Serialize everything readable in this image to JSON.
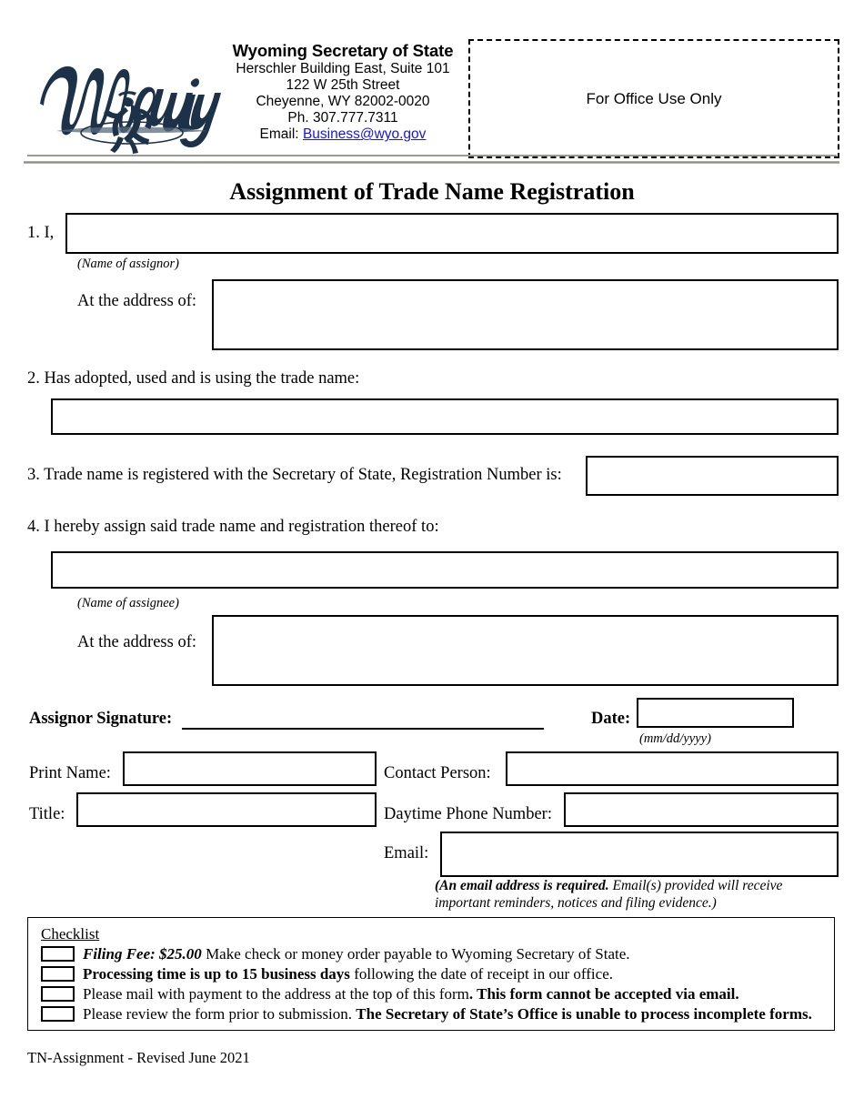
{
  "header": {
    "logo_alt": "Wyoming bucking horse logo",
    "agency_name": "Wyoming Secretary of State",
    "address_line1": "Herschler Building East, Suite 101",
    "address_line2": "122 W 25th Street",
    "address_line3": "Cheyenne, WY 82002-0020",
    "phone": "Ph. 307.777.7311",
    "email_label": "Email:",
    "email_value": "Business@wyo.gov",
    "office_use": "For Office Use Only",
    "link_color": "#1415e0"
  },
  "title": "Assignment of Trade Name Registration",
  "items": {
    "item1_label": "1. I,",
    "item1_caption": "(Name of assignor)",
    "assignor_address_label": "At the address of:",
    "item2_label": "2. Has adopted, used and is using the trade name:",
    "item3_label": "3. Trade name is registered with the Secretary of State, Registration Number is:",
    "item4_label": "4. I hereby assign said trade name and registration thereof to:",
    "item4_caption": "(Name of assignee)",
    "assignee_address_label": "At the address of:"
  },
  "signature": {
    "assignor_signature_label": "Assignor Signature:",
    "date_label": "Date:",
    "date_caption": "(mm/dd/yyyy)"
  },
  "contact": {
    "print_name_label": "Print Name:",
    "title_label": "Title:",
    "contact_person_label": "Contact Person:",
    "daytime_phone_label": "Daytime Phone Number:",
    "email_label": "Email:",
    "email_note_bold": "(An email address is required.",
    "email_note_rest": " Email(s) provided will receive important reminders, notices and filing evidence.)"
  },
  "checklist": {
    "title": "Checklist",
    "rows": [
      {
        "lead_bold_italic": "Filing Fee: $25.00",
        "text": " Make check or money order payable to Wyoming Secretary of State.",
        "trailing_bold": ""
      },
      {
        "lead_bold": "Processing time is up to 15 business days",
        "text": " following the date of receipt in our office.",
        "trailing_bold": ""
      },
      {
        "text": "Please mail with payment to the address at the top of this form",
        "trailing_bold": ". This form cannot be accepted via email."
      },
      {
        "text": "Please review the form prior to submission. ",
        "trailing_bold": "The Secretary of State’s Office is unable to process incomplete forms."
      }
    ]
  },
  "footer": "TN-Assignment - Revised June 2021",
  "fields": {
    "assignor_name": "",
    "assignor_address": "",
    "trade_name": "",
    "registration_number": "",
    "assignee_name": "",
    "assignee_address": "",
    "date": "",
    "print_name": "",
    "title": "",
    "contact_person": "",
    "daytime_phone": "",
    "email": ""
  }
}
